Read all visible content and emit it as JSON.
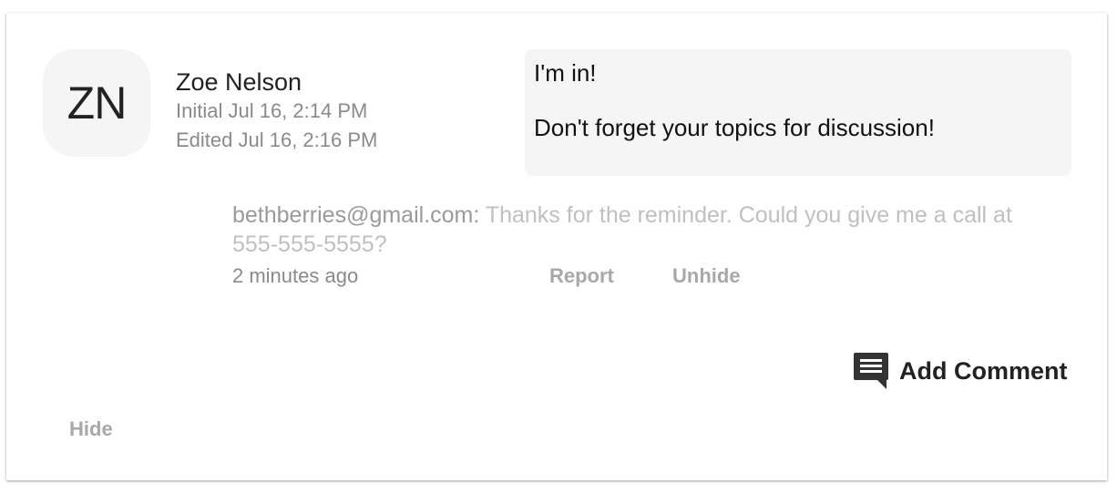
{
  "comment": {
    "avatar_initials": "ZN",
    "author_name": "Zoe Nelson",
    "initial_time": "Initial Jul 16, 2:14 PM",
    "edited_time": "Edited Jul 16, 2:16 PM",
    "body_line1": "I'm in!",
    "body_line2": "Don't forget your topics for discussion!"
  },
  "reply": {
    "author": "bethberries@gmail.com:",
    "text": "Thanks for the reminder.  Could you give me a call at 555-555-5555?",
    "time": "2 minutes ago",
    "report_label": "Report",
    "unhide_label": "Unhide"
  },
  "actions": {
    "add_comment_label": "Add Comment",
    "add_comment_icon": "comment-icon",
    "hide_label": "Hide"
  },
  "colors": {
    "avatar_bg": "#f5f5f5",
    "bubble_bg": "#f5f5f5",
    "muted_text": "#8a8a8a",
    "link_gray": "#a8a8a8",
    "icon_dark": "#333333"
  }
}
